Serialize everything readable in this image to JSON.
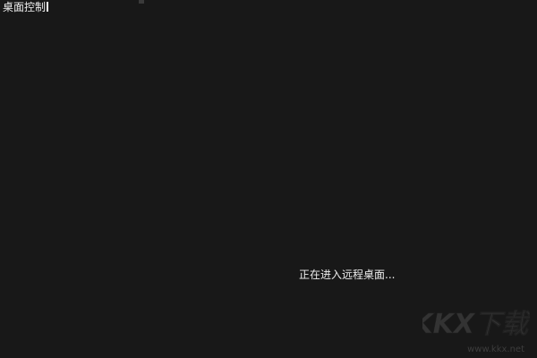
{
  "window": {
    "title": "桌面控制"
  },
  "status": {
    "message": "正在进入远程桌面..."
  },
  "watermark": {
    "logo_text": "KKX下载",
    "url": "www.kkx.net"
  }
}
